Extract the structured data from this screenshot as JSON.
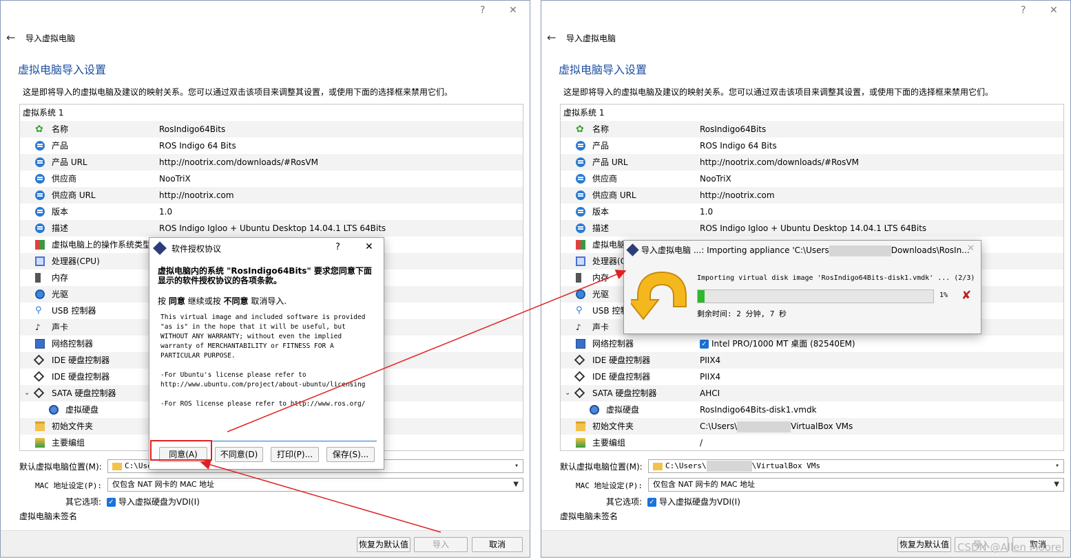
{
  "header": {
    "title": "导入虚拟电脑",
    "help": "?",
    "close": "✕",
    "back": "←"
  },
  "section_title": "虚拟电脑导入设置",
  "description": "这是即将导入的虚拟电脑及建议的映射关系。您可以通过双击该项目来调整其设置，或使用下面的选择框来禁用它们。",
  "tree": {
    "system": "虚拟系统 1",
    "rows": [
      {
        "label": "名称",
        "value": "RosIndigo64Bits",
        "icon": "clover-icon"
      },
      {
        "label": "产品",
        "value": "ROS Indigo 64 Bits",
        "icon": "info-bubble-icon"
      },
      {
        "label": "产品 URL",
        "value": "http://nootrix.com/downloads/#RosVM",
        "icon": "info-bubble-icon"
      },
      {
        "label": "供应商",
        "value": "NooTriX",
        "icon": "info-bubble-icon"
      },
      {
        "label": "供应商 URL",
        "value": "http://nootrix.com",
        "icon": "info-bubble-icon"
      },
      {
        "label": "版本",
        "value": "1.0",
        "icon": "info-bubble-icon"
      },
      {
        "label": "描述",
        "value": "ROS Indigo Igloo + Ubuntu Desktop 14.04.1 LTS 64Bits",
        "icon": "info-bubble-icon"
      },
      {
        "label": "虚拟电脑上的操作系统类型",
        "value": "",
        "icon": "os-type-icon"
      },
      {
        "label": "处理器(CPU)",
        "value": "",
        "icon": "cpu-icon"
      },
      {
        "label": "内存",
        "value": "",
        "icon": "memory-icon"
      },
      {
        "label": "光驱",
        "value": "",
        "icon": "optical-drive-icon"
      },
      {
        "label": "USB 控制器",
        "value": "",
        "icon": "usb-icon"
      },
      {
        "label": "声卡",
        "value": "",
        "icon": "sound-card-icon"
      },
      {
        "label": "网络控制器",
        "value": "Intel PRO/1000 MT 桌面 (82540EM)",
        "icon": "network-icon"
      },
      {
        "label": "IDE 硬盘控制器",
        "value": "PIIX4",
        "icon": "ide-controller-icon"
      },
      {
        "label": "IDE 硬盘控制器",
        "value": "PIIX4",
        "icon": "ide-controller-icon"
      },
      {
        "label": "SATA 硬盘控制器",
        "value": "AHCI",
        "icon": "sata-controller-icon"
      },
      {
        "label": "虚拟硬盘",
        "value": "RosIndigo64Bits-disk1.vmdk",
        "icon": "virtual-disk-icon"
      },
      {
        "label": "初始文件夹",
        "value_prefix": "C:\\Users\\",
        "value_suffix": "VirtualBox VMs",
        "icon": "folder-icon"
      },
      {
        "label": "主要编组",
        "value": "/",
        "icon": "group-icon"
      }
    ]
  },
  "bottom": {
    "location_label": "默认虚拟电脑位置(M):",
    "location_left": "C:\\User",
    "location_right_prefix": "C:\\Users\\",
    "location_right_suffix": "\\VirtualBox VMs",
    "mac_label": "MAC 地址设定(P):",
    "mac_value": "仅包含 NAT 网卡的 MAC 地址",
    "other_label": "其它选项:",
    "other_value": "导入虚拟硬盘为VDI(I)",
    "unsigned": "虚拟电脑未签名"
  },
  "footer": {
    "restore": "恢复为默认值",
    "import": "导入",
    "cancel": "取消"
  },
  "license": {
    "title": "软件授权协议",
    "help": "?",
    "close": "✕",
    "heading": "虚拟电脑内的系统 \"RosIndigo64Bits\" 要求您同意下面显示的软件授权协议的各项条款。",
    "instr_press": "按",
    "instr_agree": "同意",
    "instr_mid": "继续或按",
    "instr_disagree": "不同意",
    "instr_end": "取消导入.",
    "text": "This virtual image and included software is provided \"as is\" in the hope that it will be useful, but WITHOUT ANY WARRANTY; without even the implied warranty of MERCHANTABILITY or FITNESS FOR A PARTICULAR PURPOSE.\n\n-For Ubuntu's license please refer to http://www.ubuntu.com/project/about-ubuntu/licensing\n\n-For ROS license please refer to http://www.ros.org/",
    "btn_agree": "同意(A)",
    "btn_disagree": "不同意(D)",
    "btn_print": "打印(P)...",
    "btn_save": "保存(S)..."
  },
  "progress": {
    "title_prefix": "导入虚拟电脑 ...: Importing appliance 'C:\\Users",
    "title_suffix": "Downloads\\RosIn...",
    "close": "✕",
    "message": "Importing virtual disk image 'RosIndigo64Bits-disk1.vmdk' ... (2/3)",
    "percent_label": "1%",
    "percent": 0.01,
    "remaining": "剩余时间: 2 分钟, 7 秒"
  },
  "watermark": "CSDN @Allen Moore",
  "colors": {
    "accent": "#1e4fa0",
    "annotation": "#e02020",
    "progress": "#2eb82e"
  }
}
